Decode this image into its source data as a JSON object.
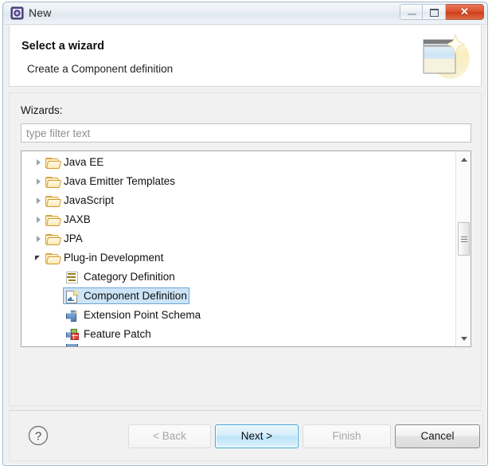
{
  "window": {
    "title": "New",
    "icon": "eclipse-new-icon",
    "controls": {
      "minimize": "minimize-button",
      "maximize": "maximize-button",
      "close_label": "✕"
    }
  },
  "banner": {
    "title": "Select a wizard",
    "subtitle": "Create a Component definition",
    "icon": "wizard-banner-icon"
  },
  "panel": {
    "wizards_label": "Wizards:",
    "filter": {
      "value": "",
      "placeholder": "type filter text"
    }
  },
  "tree": {
    "rows": [
      {
        "label": "Java EE",
        "level": 0,
        "state": "collapsed",
        "icon": "folder-icon",
        "selected": false
      },
      {
        "label": "Java Emitter Templates",
        "level": 0,
        "state": "collapsed",
        "icon": "folder-icon",
        "selected": false
      },
      {
        "label": "JavaScript",
        "level": 0,
        "state": "collapsed",
        "icon": "folder-icon",
        "selected": false
      },
      {
        "label": "JAXB",
        "level": 0,
        "state": "collapsed",
        "icon": "folder-icon",
        "selected": false
      },
      {
        "label": "JPA",
        "level": 0,
        "state": "collapsed",
        "icon": "folder-icon",
        "selected": false
      },
      {
        "label": "Plug-in Development",
        "level": 0,
        "state": "expanded",
        "icon": "folder-icon",
        "selected": false
      },
      {
        "label": "Category Definition",
        "level": 1,
        "state": "leaf",
        "icon": "category-definition-icon",
        "selected": false
      },
      {
        "label": "Component Definition",
        "level": 1,
        "state": "leaf",
        "icon": "component-definition-icon",
        "selected": true
      },
      {
        "label": "Extension Point Schema",
        "level": 1,
        "state": "leaf",
        "icon": "extension-point-schema-icon",
        "selected": false
      },
      {
        "label": "Feature Patch",
        "level": 1,
        "state": "leaf",
        "icon": "feature-patch-icon",
        "selected": false
      }
    ],
    "selected_label": "Component Definition",
    "selection_color": "#cde4f7",
    "selection_border_color": "#6ca6d6"
  },
  "scrollbar": {
    "up_arrow": "scroll-up-arrow",
    "down_arrow": "scroll-down-arrow",
    "thumb": "scroll-thumb"
  },
  "buttons": {
    "help": "?",
    "back": "< Back",
    "next": "Next >",
    "finish": "Finish",
    "cancel": "Cancel"
  }
}
